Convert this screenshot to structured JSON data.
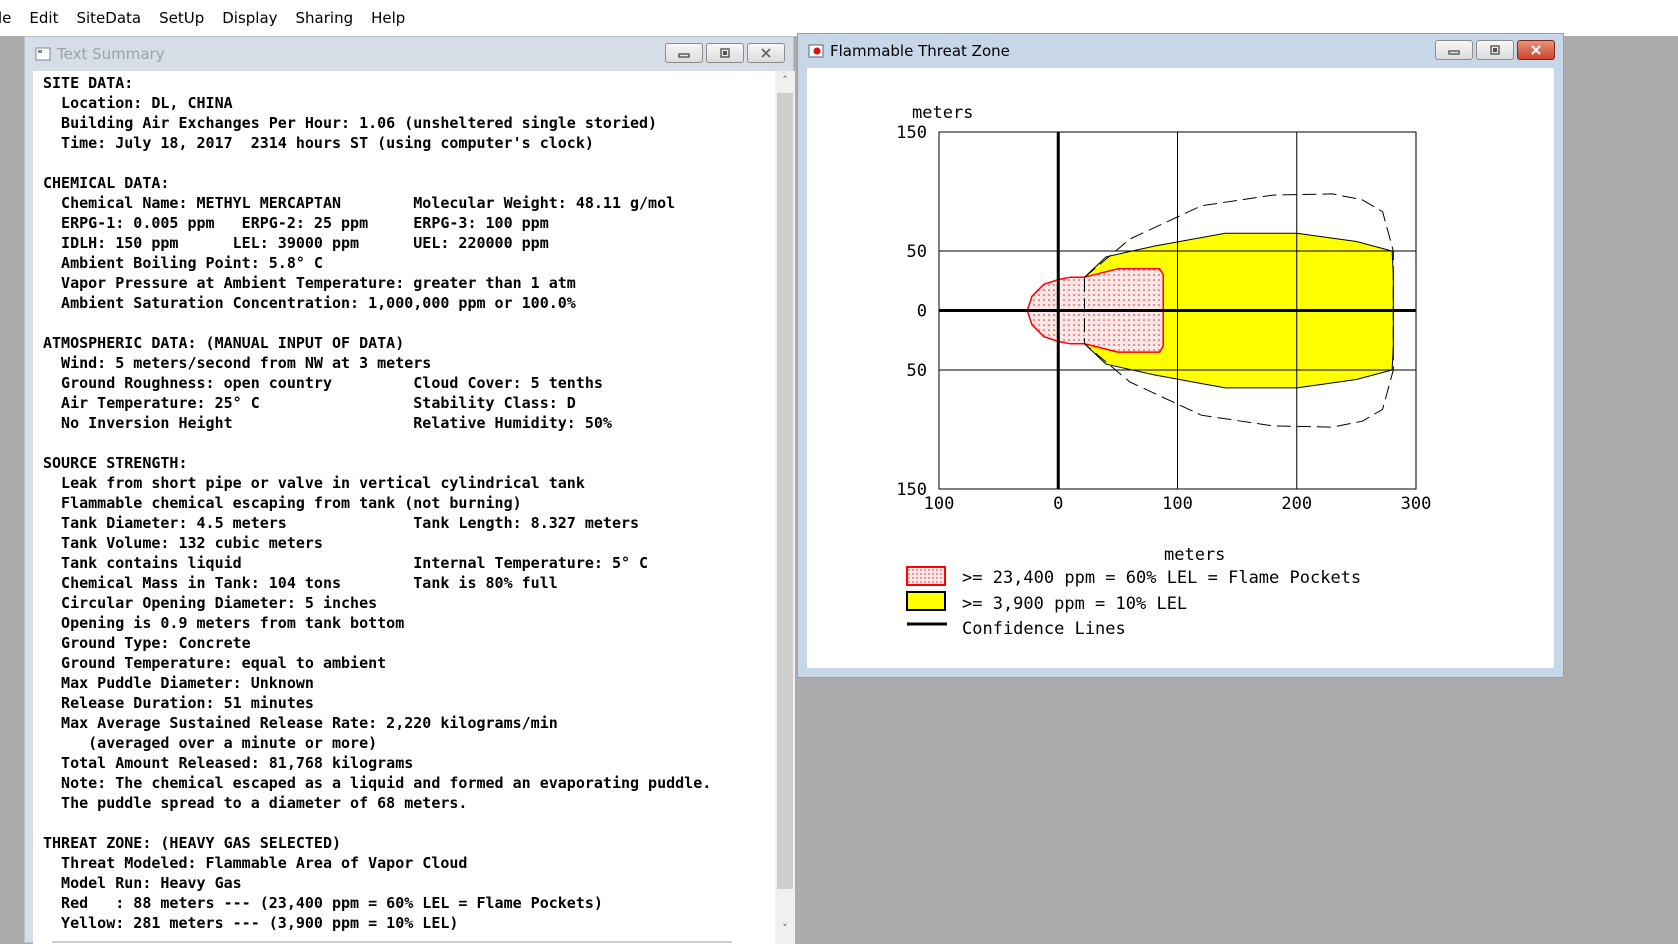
{
  "menu": [
    "le",
    "Edit",
    "SiteData",
    "SetUp",
    "Display",
    "Sharing",
    "Help"
  ],
  "text_summary": {
    "title": "Text Summary",
    "lines": [
      "SITE DATA:",
      "  Location: DL, CHINA",
      "  Building Air Exchanges Per Hour: 1.06 (unsheltered single storied)",
      "  Time: July 18, 2017  2314 hours ST (using computer's clock)",
      "",
      "CHEMICAL DATA:",
      "  Chemical Name: METHYL MERCAPTAN        Molecular Weight: 48.11 g/mol",
      "  ERPG-1: 0.005 ppm   ERPG-2: 25 ppm     ERPG-3: 100 ppm",
      "  IDLH: 150 ppm      LEL: 39000 ppm      UEL: 220000 ppm",
      "  Ambient Boiling Point: 5.8° C",
      "  Vapor Pressure at Ambient Temperature: greater than 1 atm",
      "  Ambient Saturation Concentration: 1,000,000 ppm or 100.0%",
      "",
      "ATMOSPHERIC DATA: (MANUAL INPUT OF DATA)",
      "  Wind: 5 meters/second from NW at 3 meters",
      "  Ground Roughness: open country         Cloud Cover: 5 tenths",
      "  Air Temperature: 25° C                 Stability Class: D",
      "  No Inversion Height                    Relative Humidity: 50%",
      "",
      "SOURCE STRENGTH:",
      "  Leak from short pipe or valve in vertical cylindrical tank",
      "  Flammable chemical escaping from tank (not burning)",
      "  Tank Diameter: 4.5 meters              Tank Length: 8.327 meters",
      "  Tank Volume: 132 cubic meters",
      "  Tank contains liquid                   Internal Temperature: 5° C",
      "  Chemical Mass in Tank: 104 tons        Tank is 80% full",
      "  Circular Opening Diameter: 5 inches",
      "  Opening is 0.9 meters from tank bottom",
      "  Ground Type: Concrete",
      "  Ground Temperature: equal to ambient",
      "  Max Puddle Diameter: Unknown",
      "  Release Duration: 51 minutes",
      "  Max Average Sustained Release Rate: 2,220 kilograms/min",
      "     (averaged over a minute or more)",
      "  Total Amount Released: 81,768 kilograms",
      "  Note: The chemical escaped as a liquid and formed an evaporating puddle.",
      "  The puddle spread to a diameter of 68 meters.",
      "",
      "THREAT ZONE: (HEAVY GAS SELECTED)",
      "  Threat Modeled: Flammable Area of Vapor Cloud",
      "  Model Run: Heavy Gas",
      "  Red   : 88 meters --- (23,400 ppm = 60% LEL = Flame Pockets)",
      "  Yellow: 281 meters --- (3,900 ppm = 10% LEL)"
    ]
  },
  "threat_zone": {
    "title": "Flammable Threat Zone",
    "colors": {
      "red": "#ff0000",
      "yellow": "#ffff00",
      "pocket_fill": "#fde8e8"
    },
    "chart_data": {
      "type": "area",
      "xlabel": "meters",
      "ylabel": "meters",
      "xlim": [
        -100,
        300
      ],
      "ylim": [
        -150,
        150
      ],
      "x_ticks": [
        "100",
        "0",
        "100",
        "200",
        "300"
      ],
      "y_ticks": [
        "150",
        "50",
        "0",
        "50",
        "150"
      ],
      "grid": true,
      "series": [
        {
          "name": ">= 23,400 ppm = 60% LEL = Flame Pockets",
          "color": "#ff0000",
          "points": [
            [
              22,
              28
            ],
            [
              50,
              35
            ],
            [
              85,
              35
            ],
            [
              88,
              30
            ],
            [
              88,
              -30
            ],
            [
              85,
              -35
            ],
            [
              50,
              -35
            ],
            [
              22,
              -28
            ],
            [
              10,
              -28
            ],
            [
              0,
              -26
            ],
            [
              -12,
              -22
            ],
            [
              -22,
              -12
            ],
            [
              -26,
              0
            ],
            [
              -22,
              12
            ],
            [
              -12,
              22
            ],
            [
              0,
              26
            ],
            [
              10,
              28
            ]
          ]
        },
        {
          "name": ">= 3,900 ppm = 10% LEL",
          "color": "#ffff00",
          "points": [
            [
              22,
              28
            ],
            [
              40,
              45
            ],
            [
              80,
              54
            ],
            [
              140,
              65
            ],
            [
              200,
              65
            ],
            [
              250,
              58
            ],
            [
              280,
              50
            ],
            [
              281,
              30
            ],
            [
              281,
              -30
            ],
            [
              280,
              -50
            ],
            [
              250,
              -58
            ],
            [
              200,
              -65
            ],
            [
              140,
              -65
            ],
            [
              80,
              -54
            ],
            [
              40,
              -45
            ],
            [
              22,
              -28
            ]
          ]
        },
        {
          "name": "Confidence Lines",
          "color": "#000000",
          "points": [
            [
              22,
              28
            ],
            [
              60,
              60
            ],
            [
              120,
              88
            ],
            [
              180,
              97
            ],
            [
              230,
              98
            ],
            [
              255,
              93
            ],
            [
              272,
              83
            ],
            [
              281,
              50
            ],
            [
              281,
              -50
            ],
            [
              272,
              -83
            ],
            [
              255,
              -93
            ],
            [
              230,
              -98
            ],
            [
              180,
              -97
            ],
            [
              120,
              -88
            ],
            [
              60,
              -60
            ],
            [
              22,
              -28
            ]
          ]
        }
      ],
      "legend": {
        "placement": "bottom-left",
        "entries": [
          ">= 23,400 ppm = 60% LEL = Flame Pockets",
          ">= 3,900 ppm = 10% LEL",
          "Confidence Lines"
        ]
      }
    }
  }
}
